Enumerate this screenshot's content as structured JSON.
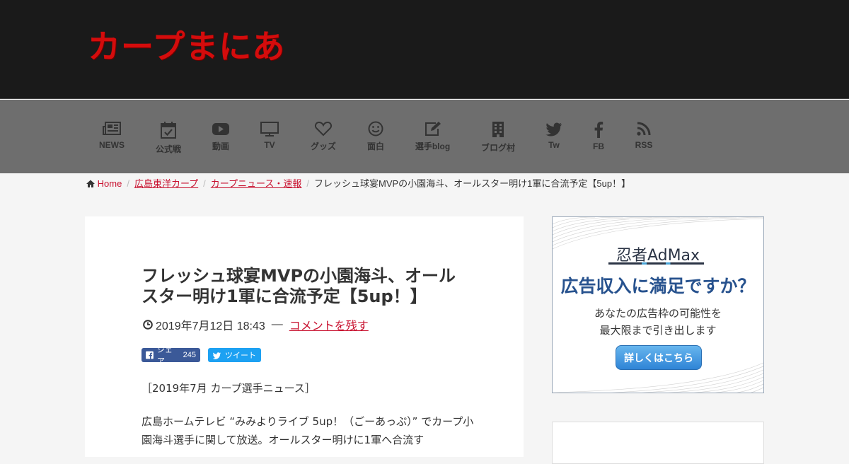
{
  "site": {
    "logo": "カープまにあ"
  },
  "nav": [
    {
      "label": "NEWS",
      "icon": "newspaper-icon"
    },
    {
      "label": "公式戦",
      "icon": "calendar-check-icon"
    },
    {
      "label": "動画",
      "icon": "youtube-icon"
    },
    {
      "label": "TV",
      "icon": "tv-icon"
    },
    {
      "label": "グッズ",
      "icon": "heart-icon"
    },
    {
      "label": "面白",
      "icon": "smile-icon"
    },
    {
      "label": "選手blog",
      "icon": "edit-icon"
    },
    {
      "label": "ブログ村",
      "icon": "building-icon"
    },
    {
      "label": "Tw",
      "icon": "twitter-icon"
    },
    {
      "label": "FB",
      "icon": "facebook-icon"
    },
    {
      "label": "RSS",
      "icon": "rss-icon"
    }
  ],
  "breadcrumb": {
    "home": "Home",
    "items": [
      "広島東洋カープ",
      "カープニュース・速報"
    ],
    "current": "フレッシュ球宴MVPの小園海斗、オールスター明け1軍に合流予定【5up！】"
  },
  "article": {
    "title": "フレッシュ球宴MVPの小園海斗、オールスター明け1軍に合流予定【5up！】",
    "date": "2019年7月12日 18:43",
    "dash": "—",
    "comment_link": "コメントを残す",
    "share_fb_label": "シェア",
    "share_fb_count": "245",
    "share_tw_label": "ツイート",
    "body_1": "［2019年7月 カープ選手ニュース］",
    "body_2": "広島ホームテレビ “みみよりライブ 5up！（ごーあっぷ）” でカープ小園海斗選手に関して放送。オールスター明けに1軍へ合流す"
  },
  "ad": {
    "brand": "忍者AdMax",
    "headline": "広告収入に満足ですか？",
    "sub_1": "あなたの広告枠の可能性を",
    "sub_2": "最大限まで引き出します",
    "button": "詳しくはこちら"
  }
}
